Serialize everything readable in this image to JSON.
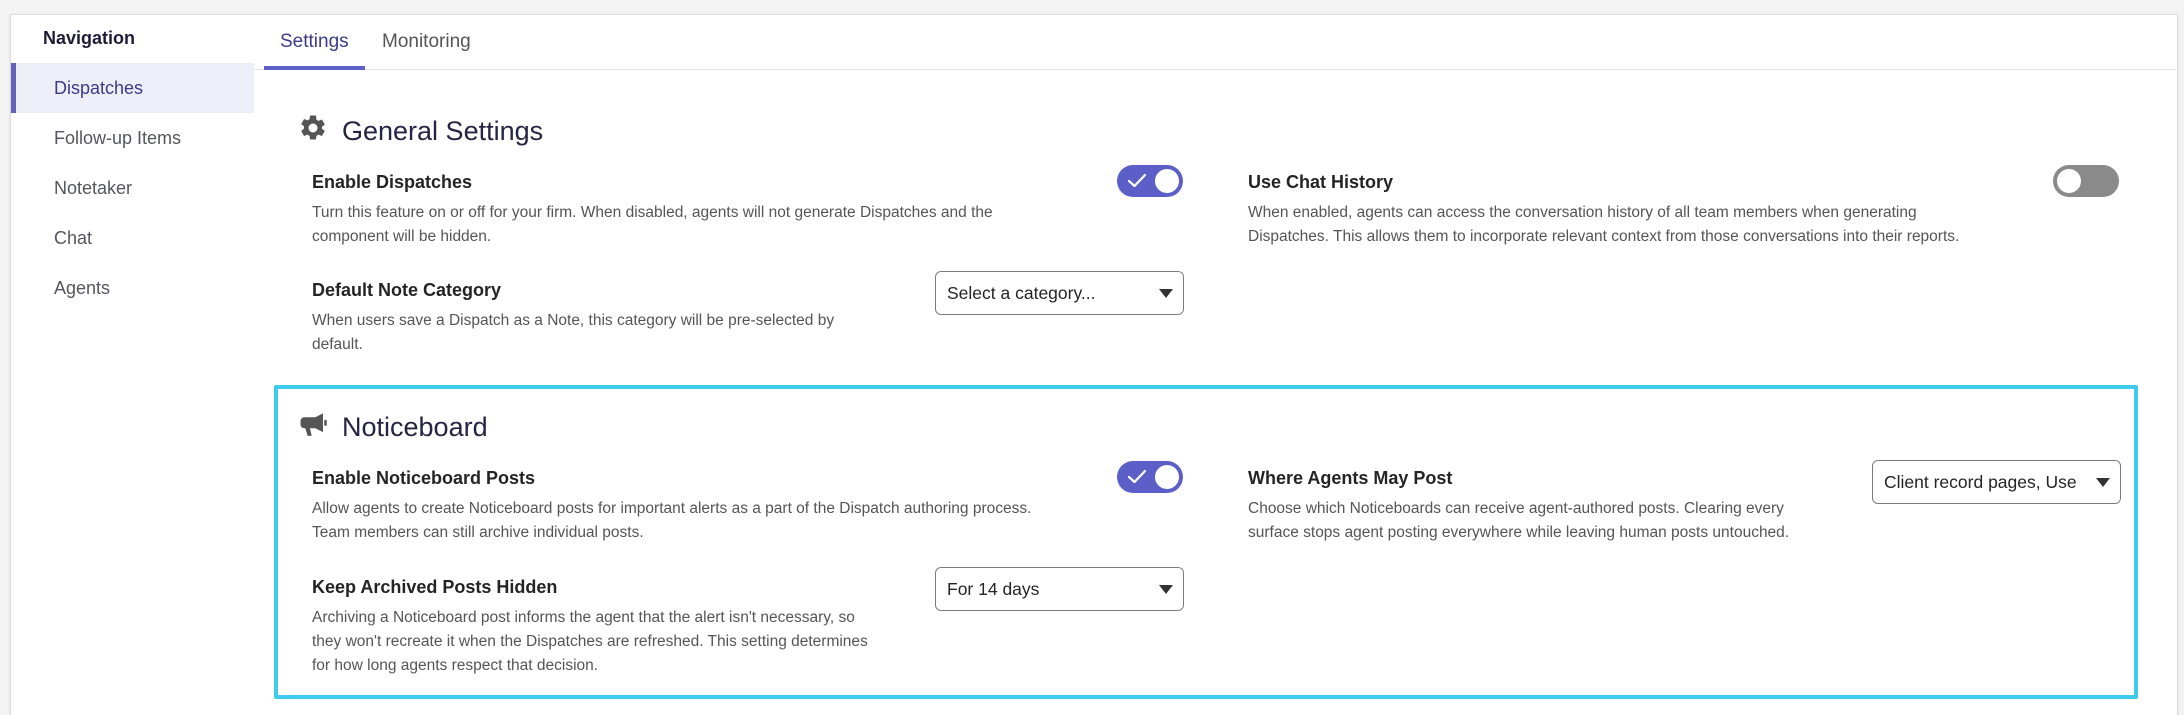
{
  "sidebar": {
    "title": "Navigation",
    "items": [
      {
        "label": "Dispatches",
        "active": true
      },
      {
        "label": "Follow-up Items",
        "active": false
      },
      {
        "label": "Notetaker",
        "active": false
      },
      {
        "label": "Chat",
        "active": false
      },
      {
        "label": "Agents",
        "active": false
      }
    ]
  },
  "tabs": [
    {
      "label": "Settings",
      "active": true
    },
    {
      "label": "Monitoring",
      "active": false
    }
  ],
  "general": {
    "title": "General Settings",
    "icon": "gear-icon",
    "enable_dispatches": {
      "label": "Enable Dispatches",
      "desc_line1": "Turn this feature on or off for your firm. When disabled, agents will not generate Dispatches and the",
      "desc_line2": "component will be hidden.",
      "toggle": "on"
    },
    "use_chat_history": {
      "label": "Use Chat History",
      "desc_line1": "When enabled, agents can access the conversation history of all team members when generating",
      "desc_line2": "Dispatches. This allows them to incorporate relevant context from those conversations into their reports.",
      "toggle": "off"
    },
    "default_note_category": {
      "label": "Default Note Category",
      "desc_line1": "When users save a Dispatch as a Note, this category will be pre-selected by",
      "desc_line2": "default.",
      "select_value": "Select a category..."
    }
  },
  "noticeboard": {
    "title": "Noticeboard",
    "icon": "megaphone-icon",
    "enable_posts": {
      "label": "Enable Noticeboard Posts",
      "desc_line1": "Allow agents to create Noticeboard posts for important alerts as a part of the Dispatch authoring process.",
      "desc_line2": "Team members can still archive individual posts.",
      "toggle": "on"
    },
    "where_agents_may_post": {
      "label": "Where Agents May Post",
      "desc_line1": "Choose which Noticeboards can receive agent-authored posts. Clearing every",
      "desc_line2": "surface stops agent posting everywhere while leaving human posts untouched.",
      "select_value": "Client record pages, Use"
    },
    "keep_archived_hidden": {
      "label": "Keep Archived Posts Hidden",
      "desc_line1": "Archiving a Noticeboard post informs the agent that the alert isn't necessary, so",
      "desc_line2": "they won't recreate it when the Dispatches are refreshed. This setting determines",
      "desc_line3": "for how long agents respect that decision.",
      "select_value": "For 14 days"
    }
  },
  "colors": {
    "accent": "#5b5fc7",
    "highlight": "#3ecbee",
    "toggle_off": "#8a8a8a"
  }
}
